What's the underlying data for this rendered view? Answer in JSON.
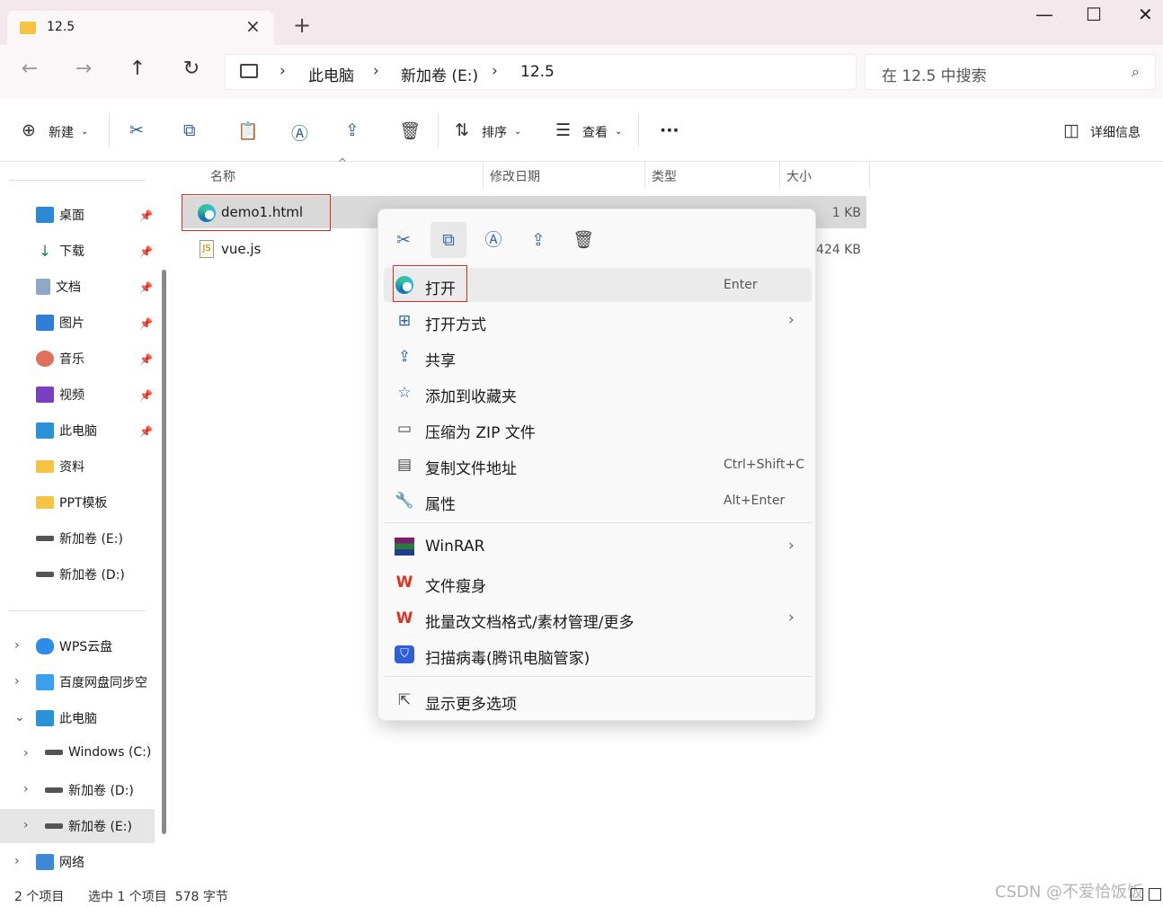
{
  "tab": {
    "title": "12.5"
  },
  "window": {
    "minimize": "—",
    "maximize": "☐",
    "close": "✕"
  },
  "breadcrumb": [
    "此电脑",
    "新加卷 (E:)",
    "12.5"
  ],
  "search": {
    "placeholder": "在 12.5 中搜索"
  },
  "toolbar": {
    "new_label": "新建",
    "sort_label": "排序",
    "view_label": "查看",
    "details_label": "详细信息"
  },
  "sidebar": {
    "quick": [
      "桌面",
      "下载",
      "文档",
      "图片",
      "音乐",
      "视频",
      "此电脑",
      "资料",
      "PPT模板",
      "新加卷 (E:)",
      "新加卷 (D:)"
    ],
    "tree": [
      "WPS云盘",
      "百度网盘同步空",
      "此电脑",
      "Windows (C:)",
      "新加卷 (D:)",
      "新加卷 (E:)",
      "网络"
    ]
  },
  "columns": {
    "name": "名称",
    "modified": "修改日期",
    "type": "类型",
    "size": "大小"
  },
  "files": [
    {
      "name": "demo1.html",
      "size": "1 KB"
    },
    {
      "name": "vue.js",
      "size": "424 KB"
    }
  ],
  "menu": {
    "items": [
      {
        "label": "打开",
        "shortcut": "Enter"
      },
      {
        "label": "打开方式"
      },
      {
        "label": "共享"
      },
      {
        "label": "添加到收藏夹"
      },
      {
        "label": "压缩为 ZIP 文件"
      },
      {
        "label": "复制文件地址",
        "shortcut": "Ctrl+Shift+C"
      },
      {
        "label": "属性",
        "shortcut": "Alt+Enter"
      },
      {
        "label": "WinRAR"
      },
      {
        "label": "文件瘦身"
      },
      {
        "label": "批量改文档格式/素材管理/更多"
      },
      {
        "label": "扫描病毒(腾讯电脑管家)"
      },
      {
        "label": "显示更多选项"
      }
    ]
  },
  "status": {
    "count": "2 个项目",
    "selection": "选中 1 个项目  578 字节"
  },
  "watermark": "CSDN @不爱恰饭饭",
  "colors": {
    "accent": "#2e5d9e",
    "highlight_box": "#e02a2a",
    "titlebar": "#f3e9ec"
  }
}
